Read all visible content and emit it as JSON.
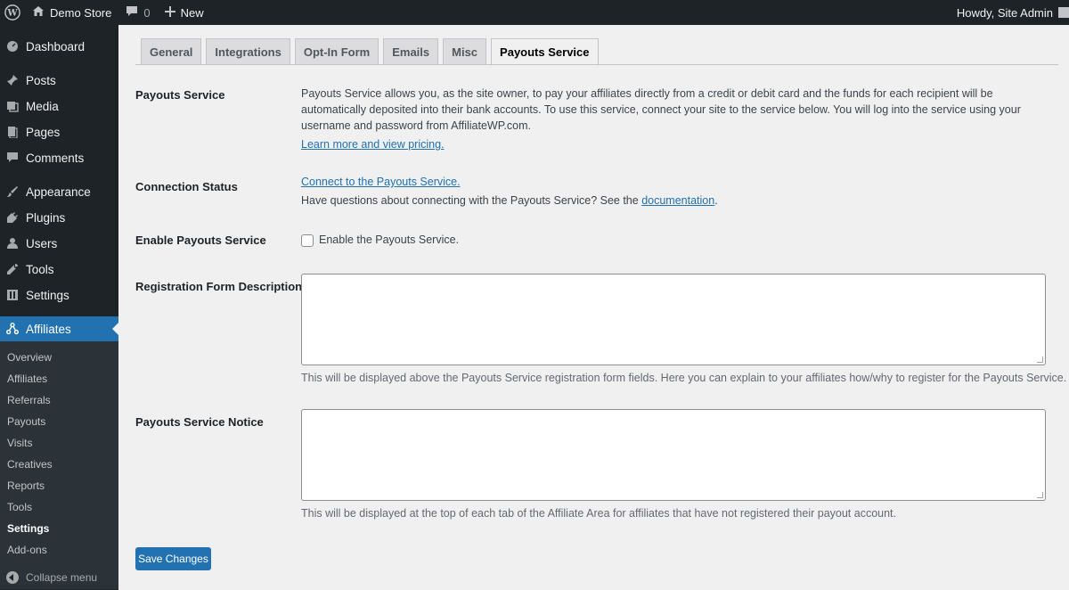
{
  "adminbar": {
    "site_name": "Demo Store",
    "comments_count": "0",
    "new_label": "New",
    "greeting": "Howdy, Site Admin"
  },
  "sidebar": {
    "items": [
      {
        "label": "Dashboard",
        "icon": "dashboard-icon"
      },
      {
        "label": "Posts",
        "icon": "pin-icon"
      },
      {
        "label": "Media",
        "icon": "media-icon"
      },
      {
        "label": "Pages",
        "icon": "pages-icon"
      },
      {
        "label": "Comments",
        "icon": "comment-icon"
      },
      {
        "label": "Appearance",
        "icon": "brush-icon"
      },
      {
        "label": "Plugins",
        "icon": "plug-icon"
      },
      {
        "label": "Users",
        "icon": "user-icon"
      },
      {
        "label": "Tools",
        "icon": "wrench-icon"
      },
      {
        "label": "Settings",
        "icon": "settings-icon"
      },
      {
        "label": "Affiliates",
        "icon": "affiliates-icon"
      }
    ],
    "submenu": [
      "Overview",
      "Affiliates",
      "Referrals",
      "Payouts",
      "Visits",
      "Creatives",
      "Reports",
      "Tools",
      "Settings",
      "Add-ons"
    ],
    "current_submenu": "Settings",
    "collapse_label": "Collapse menu"
  },
  "tabs": [
    "General",
    "Integrations",
    "Opt-In Form",
    "Emails",
    "Misc",
    "Payouts Service"
  ],
  "active_tab": "Payouts Service",
  "form": {
    "payouts_service": {
      "label": "Payouts Service",
      "description": "Payouts Service allows you, as the site owner, to pay your affiliates directly from a credit or debit card and the funds for each recipient will be automatically deposited into their bank accounts. To use this service, connect your site to the service below. You will log into the service using your username and password from AffiliateWP.com.",
      "link": "Learn more and view pricing."
    },
    "connection_status": {
      "label": "Connection Status",
      "connect_link": "Connect to the Payouts Service.",
      "help_prefix": "Have questions about connecting with the Payouts Service? See the",
      "help_link": "documentation",
      "help_suffix": "."
    },
    "enable": {
      "label": "Enable Payouts Service",
      "checkbox_label": "Enable the Payouts Service.",
      "checked": false
    },
    "registration": {
      "label": "Registration Form Description",
      "value": "",
      "help": "This will be displayed above the Payouts Service registration form fields. Here you can explain to your affiliates how/why to register for the Payouts Service."
    },
    "notice": {
      "label": "Payouts Service Notice",
      "value": "",
      "help": "This will be displayed at the top of each tab of the Affiliate Area for affiliates that have not registered their payout account."
    },
    "save_label": "Save Changes"
  },
  "colors": {
    "adminbar_bg": "#1d2327",
    "accent": "#2271b1",
    "page_bg": "#f0f0f1"
  }
}
